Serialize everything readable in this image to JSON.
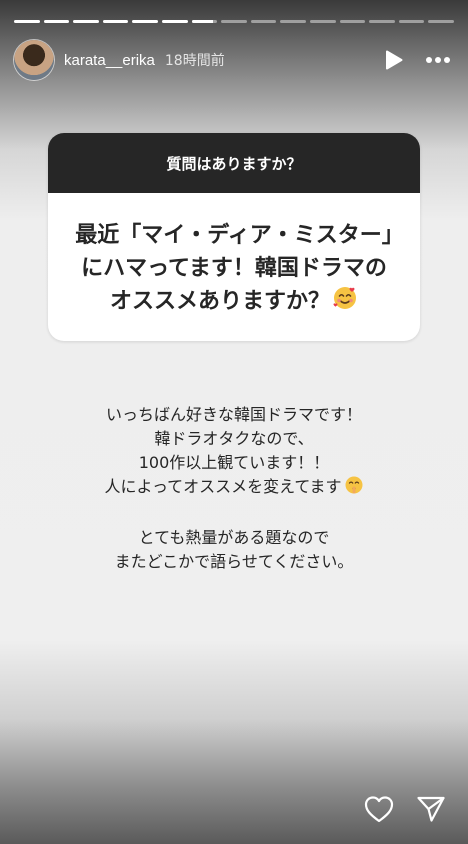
{
  "progress": {
    "segments": [
      1,
      1,
      1,
      1,
      1,
      1,
      0.85,
      0,
      0,
      0,
      0,
      0,
      0,
      0,
      0
    ]
  },
  "header": {
    "username": "karata__erika",
    "time": "18時間前",
    "icons": [
      "play-icon",
      "more-icon"
    ]
  },
  "question": {
    "prompt": "質問はありますか？",
    "text": "最近「マイ・ディア・ミスター」にハマってます！韓国ドラマのオススメありますか？"
  },
  "answer": {
    "paragraph1": [
      "いっちばん好きな韓国ドラマです！",
      "韓ドラオタクなので、",
      "100作以上観ています！！",
      "人によってオススメを変えてます"
    ],
    "paragraph2": [
      "とても熱量がある題なので",
      "またどこかで語らせてください。"
    ]
  },
  "actions": {
    "icons": [
      "heart-icon",
      "send-icon"
    ]
  },
  "colors": {
    "card_header": "#262626",
    "text": "#262626",
    "emoji": "#f6c343"
  }
}
